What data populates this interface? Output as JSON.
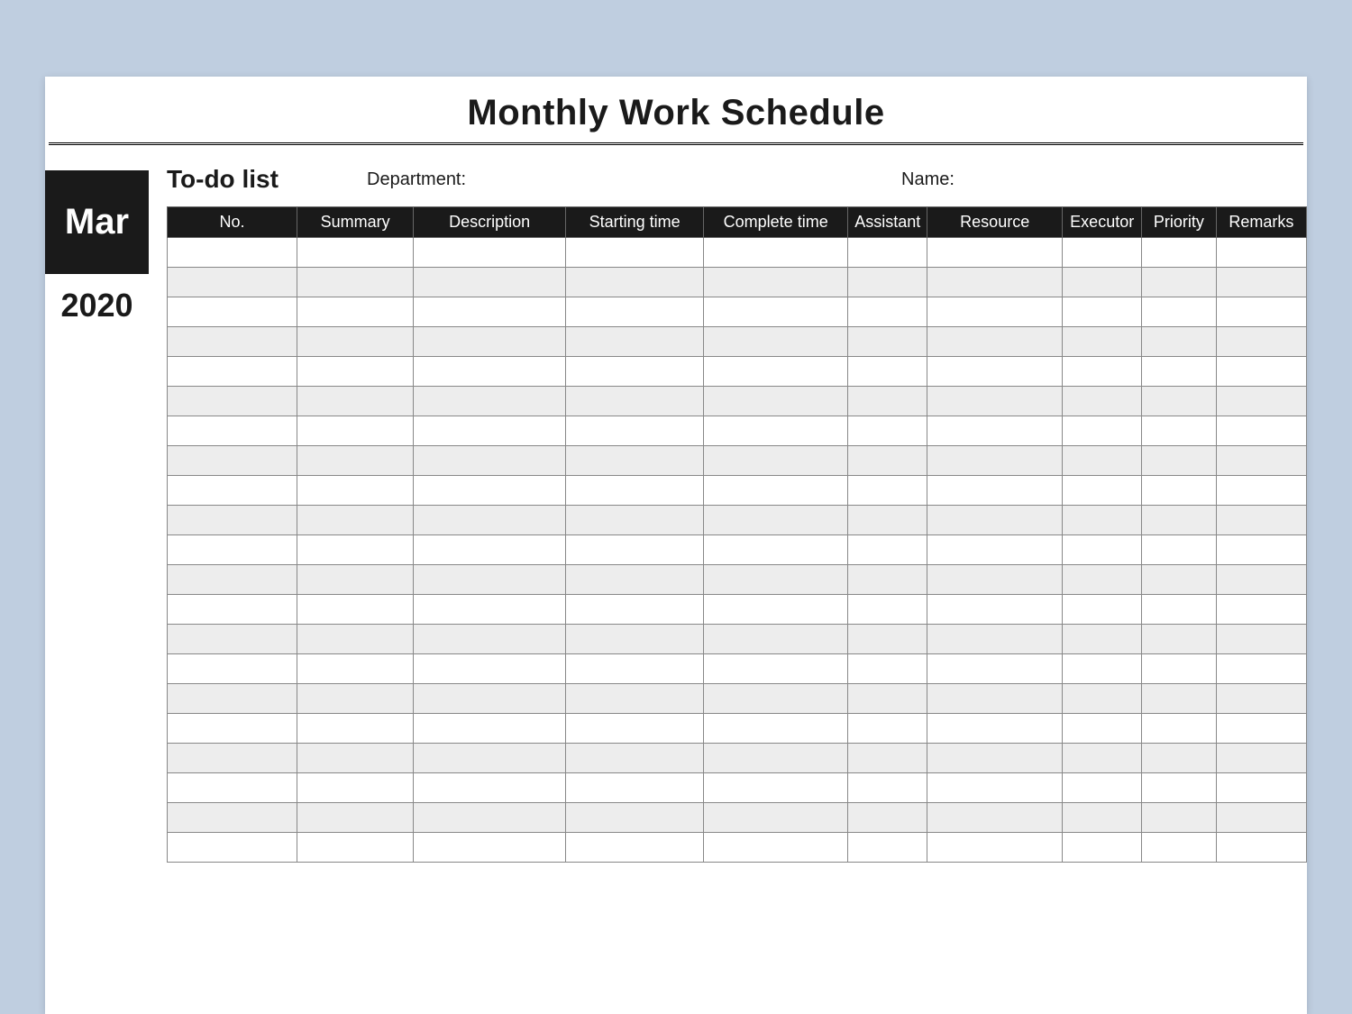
{
  "title": "Monthly Work Schedule",
  "date": {
    "month": "Mar",
    "year": "2020"
  },
  "meta": {
    "todo_label": "To-do list",
    "department_label": "Department:",
    "name_label": "Name:"
  },
  "columns": {
    "no": "No.",
    "summary": "Summary",
    "description": "Description",
    "starting_time": "Starting time",
    "complete_time": "Complete time",
    "assistant": "Assistant",
    "resource": "Resource",
    "executor": "Executor",
    "priority": "Priority",
    "remarks": "Remarks"
  },
  "row_count": 21
}
